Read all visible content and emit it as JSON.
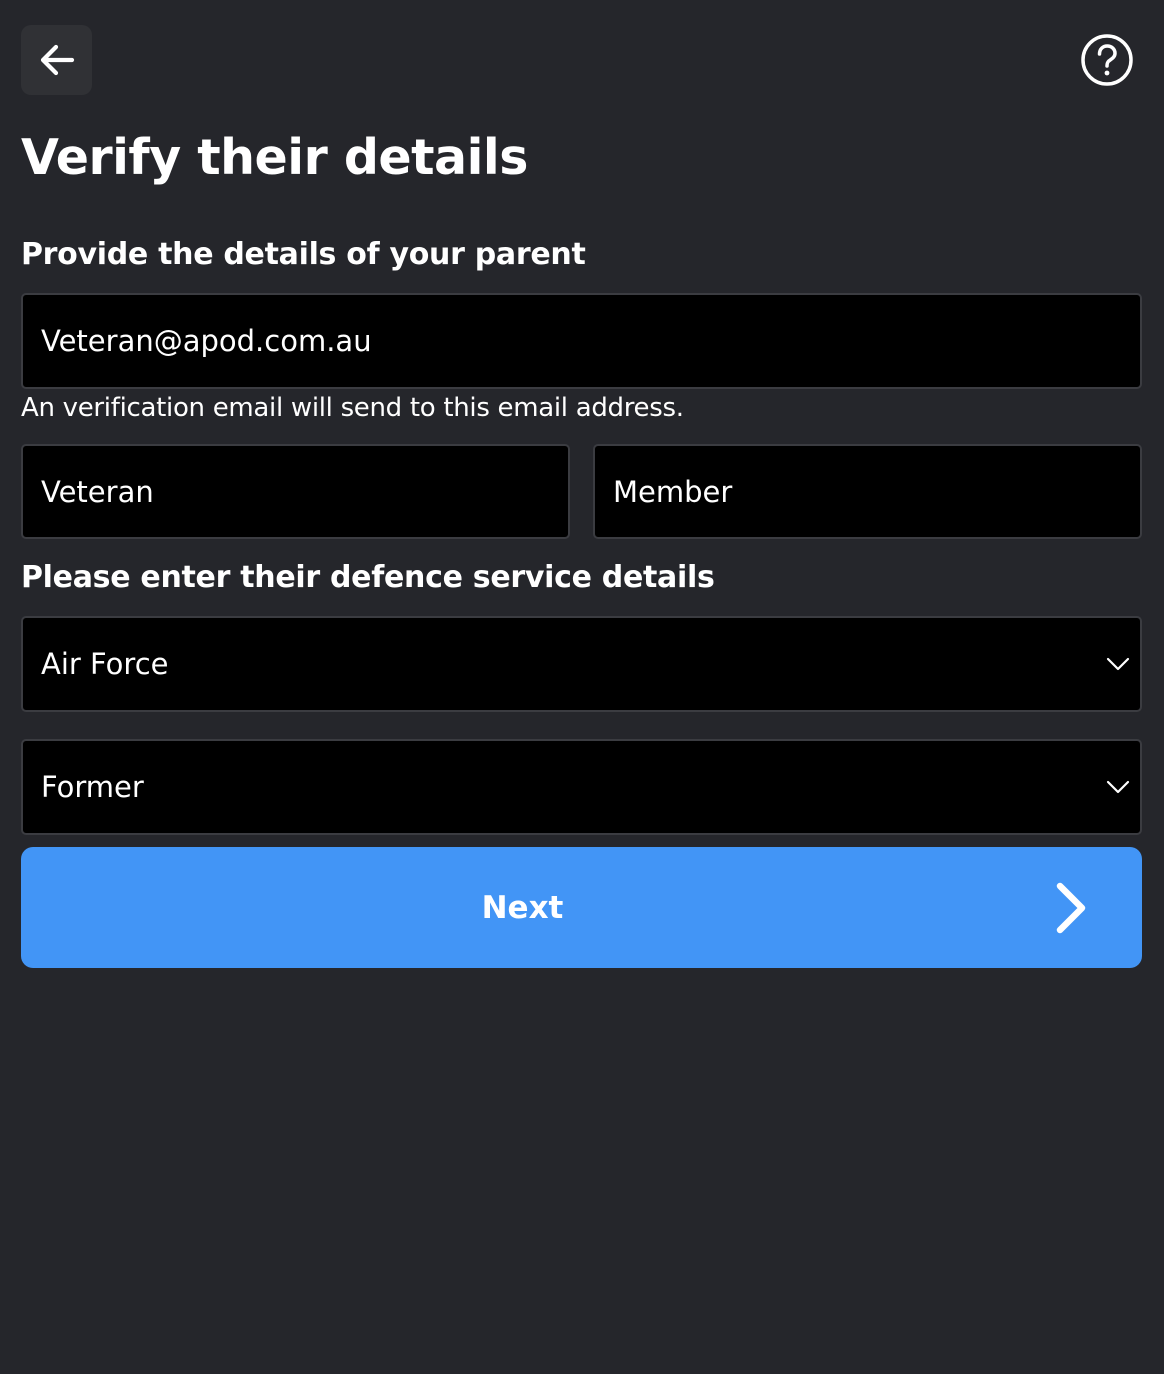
{
  "header": {
    "back_icon": "arrow-left-icon",
    "help_icon": "question-circle-icon"
  },
  "page": {
    "title": "Verify their details"
  },
  "parent_section": {
    "label": "Provide the details of your parent",
    "email_value": "Veteran@apod.com.au",
    "email_hint": "An verification email will send to this email address.",
    "first_name_value": "Veteran",
    "last_name_value": "Member"
  },
  "service_section": {
    "label": "Please enter their defence service details",
    "branch_value": "Air Force",
    "status_value": "Former",
    "dropdown_icon": "chevron-down-icon"
  },
  "actions": {
    "next_label": "Next",
    "next_icon": "chevron-right-icon"
  },
  "colors": {
    "background": "#25262b",
    "field_background": "#000000",
    "primary_button": "#4295f6",
    "text": "#ffffff"
  }
}
